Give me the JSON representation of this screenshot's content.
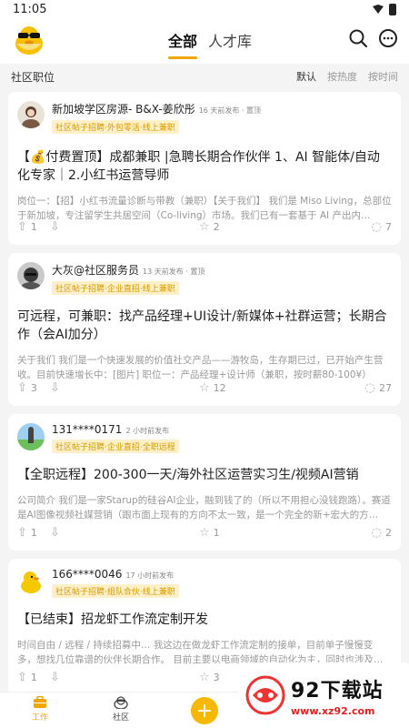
{
  "status": {
    "time": "11:05"
  },
  "header": {
    "tabs": [
      {
        "label": "全部"
      },
      {
        "label": "人才库"
      }
    ]
  },
  "section": {
    "title": "社区职位",
    "sort": [
      "默认",
      "按热度",
      "按时间"
    ]
  },
  "posts": [
    {
      "author": "新加坡学区房源- B&X-姜欣彤",
      "meta": "16 天前发布 · 置顶",
      "tags": "社区帖子招聘·外包零活·线上兼职",
      "title": "【💰付费置顶】成都兼职 |急聘长期合作伙伴 1、AI 智能体/自动化专家｜2.小红书运营导师",
      "body": "岗位一：【招】小红书流量诊断与带教（兼职）【关于我们】 我们是 Miso Living，总部位于新加坡，专注留学生共居空间（Co-living）市场。我们已有一套基于 AI 产出内…",
      "up": "1",
      "star": "2",
      "comments": "7"
    },
    {
      "author": "大灰@社区服务员",
      "meta": "13 天前发布 · 置顶",
      "tags": "社区帖子招聘·企业直招·线上兼职",
      "title": "可远程，可兼职：找产品经理+UI设计/新媒体+社群运营；长期合作（会AI加分）",
      "body": "关于我们 我们是一个快速发展的价值社交产品——游牧岛，生存期已过，已开始产生营收。目前快速增长中：[图片] 职位一：产品经理+设计师（兼职，按时薪80-100¥） 既…",
      "up": "3",
      "star": "12",
      "comments": "27"
    },
    {
      "author": "131****0171",
      "meta": "2 小时前发布",
      "tags": "社区帖子招聘·企业直招·全职远程",
      "title": "【全职远程】200-300一天/海外社区运营实习生/视频AI营销",
      "body": "公司简介 我们是一家Starup的硅谷AI企业，融到钱了的（所以不用担心没钱跑路）。赛道是AI图像视频社媒营销（跟市面上现有的方向不太一致，是一个完全的新+宏大的方…",
      "up": "1",
      "star": "1",
      "comments": "2"
    },
    {
      "author": "166****0046",
      "meta": "17 小时前发布",
      "tags": "社区帖子招聘·组队合伙·线上兼职",
      "title": "【已结束】招龙虾工作流定制开发",
      "body": "时间自由 / 远程 / 持续招募中… 我这边在做龙虾工作流定制的接单，目前单子慢慢变多，想找几位靠谱的伙伴长期合作。 目前主要以电商领域的自动化为主，同时也涉及…",
      "up": "1",
      "star": "3",
      "comments": ""
    }
  ],
  "nav": {
    "work": "工作",
    "community": "社区",
    "add": "+"
  },
  "watermark": {
    "main": "92下载站",
    "url": "www.xz92.com"
  },
  "colors": {
    "accent": "#f0a500",
    "tag_bg": "#fdf0c9"
  }
}
